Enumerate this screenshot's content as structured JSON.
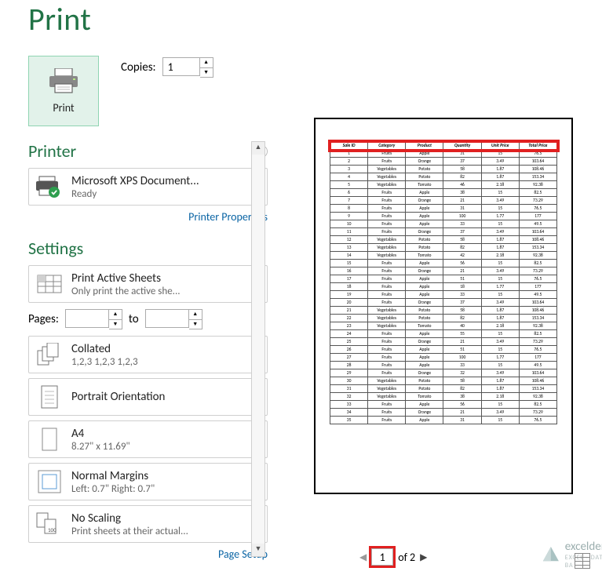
{
  "title": "Print",
  "print_button_label": "Print",
  "copies": {
    "label": "Copies:",
    "value": "1"
  },
  "printer": {
    "heading": "Printer",
    "name": "Microsoft XPS Document...",
    "status": "Ready",
    "props_link": "Printer Properties"
  },
  "settings": {
    "heading": "Settings",
    "active_sheets": {
      "l1": "Print Active Sheets",
      "l2": "Only print the active she..."
    },
    "pages": {
      "label": "Pages:",
      "to": "to"
    },
    "collated": {
      "l1": "Collated",
      "l2": "1,2,3    1,2,3    1,2,3"
    },
    "orientation": {
      "l1": "Portrait Orientation"
    },
    "paper": {
      "l1": "A4",
      "l2": "8.27\" x 11.69\""
    },
    "margins": {
      "l1": "Normal Margins",
      "l2": "Left: 0.7\"    Right: 0.7\""
    },
    "scaling": {
      "l1": "No Scaling",
      "l2": "Print sheets at their actual..."
    },
    "page_setup": "Page Setup"
  },
  "pager": {
    "current": "1",
    "of_label": "of 2"
  },
  "watermark": {
    "brand": "exceldemy",
    "tag": "EXCEL · DATA · BA"
  },
  "chart_data": {
    "type": "table",
    "columns": [
      "Sale ID",
      "Category",
      "Product",
      "Quantity",
      "Unit Price",
      "Total Price"
    ],
    "rows": [
      [
        "1",
        "Fruits",
        "Apple",
        "31",
        "15",
        "76.5"
      ],
      [
        "2",
        "Fruits",
        "Orange",
        "37",
        "3.49",
        "103.64"
      ],
      [
        "3",
        "Vegetables",
        "Potato",
        "58",
        "1.87",
        "108.46"
      ],
      [
        "4",
        "Vegetables",
        "Potato",
        "82",
        "1.87",
        "153.34"
      ],
      [
        "5",
        "Vegetables",
        "Tomato",
        "46",
        "2.18",
        "92.38"
      ],
      [
        "6",
        "Fruits",
        "Apple",
        "38",
        "15",
        "82.5"
      ],
      [
        "7",
        "Fruits",
        "Orange",
        "21",
        "3.49",
        "73.29"
      ],
      [
        "8",
        "Fruits",
        "Apple",
        "31",
        "15",
        "76.5"
      ],
      [
        "9",
        "Fruits",
        "Apple",
        "100",
        "1.77",
        "177"
      ],
      [
        "10",
        "Fruits",
        "Apple",
        "33",
        "15",
        "49.5"
      ],
      [
        "11",
        "Fruits",
        "Orange",
        "37",
        "3.49",
        "103.64"
      ],
      [
        "12",
        "Vegetables",
        "Potato",
        "58",
        "1.87",
        "108.46"
      ],
      [
        "13",
        "Vegetables",
        "Potato",
        "82",
        "1.87",
        "153.34"
      ],
      [
        "14",
        "Vegetables",
        "Tomato",
        "42",
        "2.18",
        "92.38"
      ],
      [
        "15",
        "Fruits",
        "Apple",
        "56",
        "15",
        "82.5"
      ],
      [
        "16",
        "Fruits",
        "Orange",
        "21",
        "3.49",
        "73.29"
      ],
      [
        "17",
        "Fruits",
        "Apple",
        "51",
        "15",
        "76.5"
      ],
      [
        "18",
        "Fruits",
        "Apple",
        "18",
        "1.77",
        "177"
      ],
      [
        "19",
        "Fruits",
        "Apple",
        "33",
        "15",
        "49.5"
      ],
      [
        "20",
        "Fruits",
        "Orange",
        "37",
        "3.49",
        "103.64"
      ],
      [
        "21",
        "Vegetables",
        "Potato",
        "58",
        "1.87",
        "108.46"
      ],
      [
        "22",
        "Vegetables",
        "Potato",
        "82",
        "1.87",
        "153.34"
      ],
      [
        "23",
        "Vegetables",
        "Tomato",
        "40",
        "2.18",
        "92.38"
      ],
      [
        "24",
        "Fruits",
        "Apple",
        "55",
        "15",
        "82.5"
      ],
      [
        "25",
        "Fruits",
        "Orange",
        "21",
        "3.49",
        "73.29"
      ],
      [
        "26",
        "Fruits",
        "Apple",
        "51",
        "15",
        "76.5"
      ],
      [
        "27",
        "Fruits",
        "Apple",
        "100",
        "1.77",
        "177"
      ],
      [
        "28",
        "Fruits",
        "Apple",
        "33",
        "15",
        "49.5"
      ],
      [
        "29",
        "Fruits",
        "Orange",
        "32",
        "3.49",
        "103.64"
      ],
      [
        "30",
        "Vegetables",
        "Potato",
        "58",
        "1.87",
        "108.46"
      ],
      [
        "31",
        "Vegetables",
        "Potato",
        "82",
        "1.87",
        "153.34"
      ],
      [
        "32",
        "Vegetables",
        "Tomato",
        "38",
        "2.18",
        "92.38"
      ],
      [
        "33",
        "Fruits",
        "Apple",
        "56",
        "15",
        "82.5"
      ],
      [
        "34",
        "Fruits",
        "Orange",
        "21",
        "3.49",
        "73.29"
      ],
      [
        "35",
        "Fruits",
        "Apple",
        "31",
        "15",
        "76.5"
      ]
    ]
  }
}
